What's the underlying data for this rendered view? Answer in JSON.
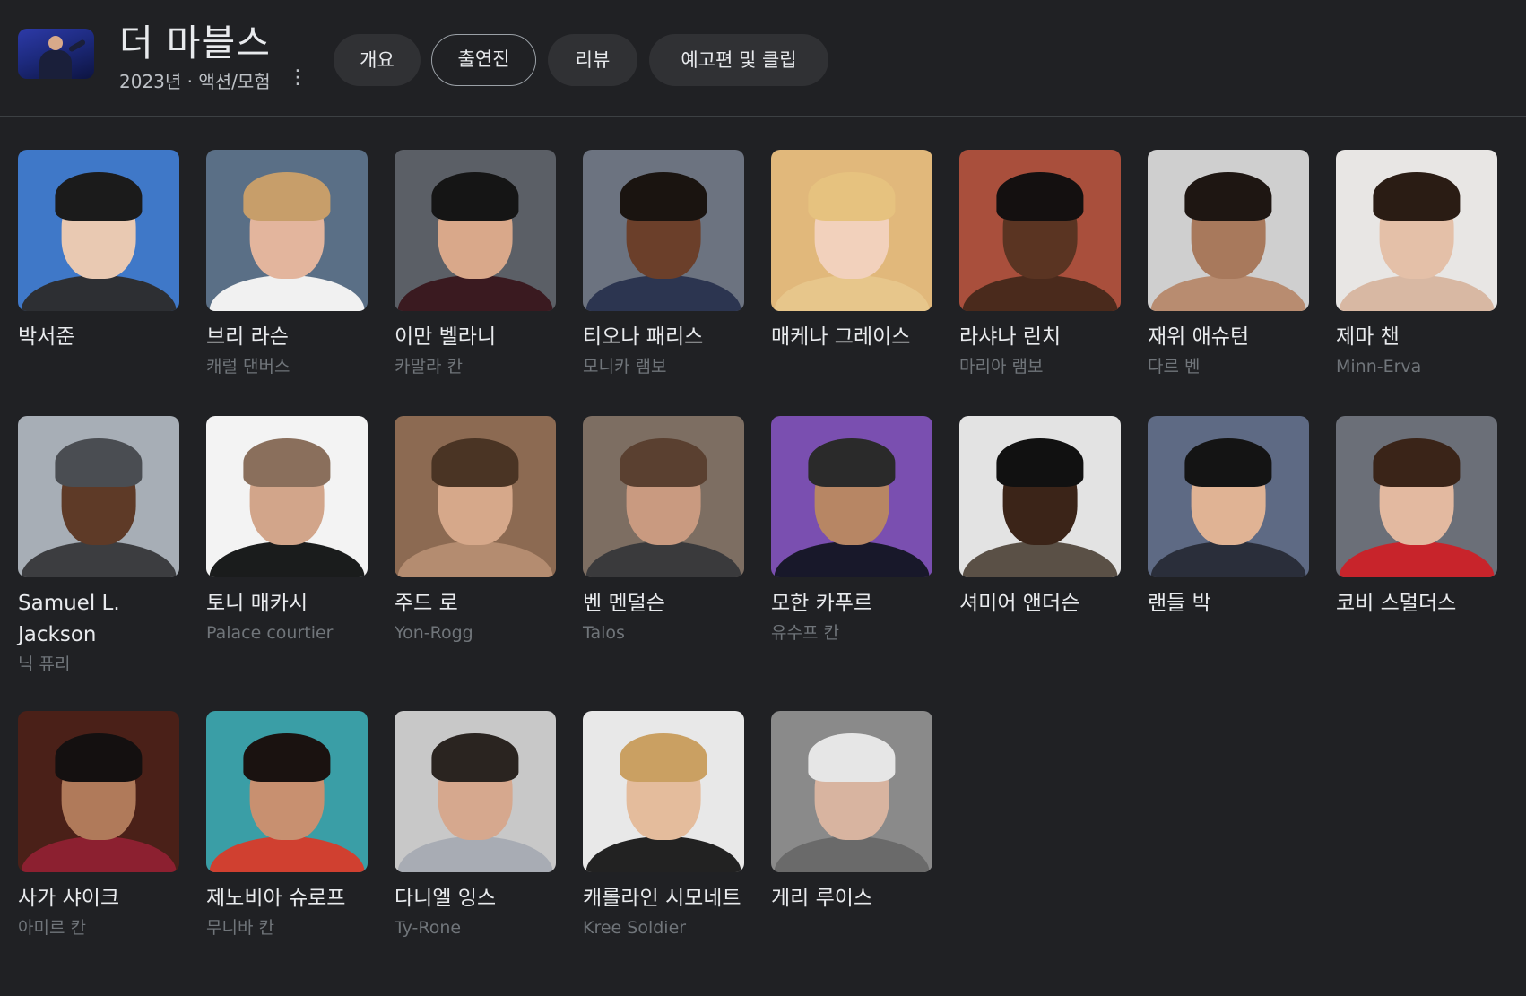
{
  "movie": {
    "title": "더 마블스",
    "subtitle": "2023년 · 액션/모험"
  },
  "tabs": [
    {
      "label": "개요",
      "selected": false
    },
    {
      "label": "출연진",
      "selected": true
    },
    {
      "label": "리뷰",
      "selected": false
    },
    {
      "label": "예고편 및 클립",
      "selected": false
    }
  ],
  "cast": [
    {
      "name": "박서준",
      "role": "",
      "colors": {
        "bg": "#3f78c8",
        "skin": "#e9c9b2",
        "cloth": "#2d2f33",
        "hair": "#1b1b1b"
      }
    },
    {
      "name": "브리 라슨",
      "role": "캐럴 댄버스",
      "colors": {
        "bg": "#5a6f86",
        "skin": "#e3b59d",
        "cloth": "#f1f1f1",
        "hair": "#c79e6a"
      }
    },
    {
      "name": "이만 벨라니",
      "role": "카말라 칸",
      "colors": {
        "bg": "#5b5f66",
        "skin": "#d9a88a",
        "cloth": "#3a1a20",
        "hair": "#151515"
      }
    },
    {
      "name": "티오나 패리스",
      "role": "모니카 램보",
      "colors": {
        "bg": "#6c7380",
        "skin": "#6b3f2a",
        "cloth": "#2c3550",
        "hair": "#1a1410"
      }
    },
    {
      "name": "매케나 그레이스",
      "role": "",
      "colors": {
        "bg": "#e1b87b",
        "skin": "#f2d1bc",
        "cloth": "#e7c68b",
        "hair": "#e6c27f"
      }
    },
    {
      "name": "라샤나 린치",
      "role": "마리아 램보",
      "colors": {
        "bg": "#a94f3c",
        "skin": "#5a3422",
        "cloth": "#4a2a1c",
        "hair": "#141010"
      }
    },
    {
      "name": "재위 애슈턴",
      "role": "다르 벤",
      "colors": {
        "bg": "#cfcfcf",
        "skin": "#a8795c",
        "cloth": "#b88c70",
        "hair": "#1e1612"
      }
    },
    {
      "name": "제마 챈",
      "role": "Minn-Erva",
      "colors": {
        "bg": "#e8e6e4",
        "skin": "#e4c0a8",
        "cloth": "#d8b8a3",
        "hair": "#2a1c14"
      }
    },
    {
      "name": "Samuel L. Jackson",
      "role": "닉 퓨리",
      "colors": {
        "bg": "#a7aeb6",
        "skin": "#5e3a27",
        "cloth": "#3c3d40",
        "hair": "#4a4d52"
      }
    },
    {
      "name": "토니 매카시",
      "role": "Palace courtier",
      "colors": {
        "bg": "#f3f3f3",
        "skin": "#d2a58a",
        "cloth": "#1a1c1c",
        "hair": "#8a6f5c"
      }
    },
    {
      "name": "주드 로",
      "role": "Yon-Rogg",
      "colors": {
        "bg": "#8c6a52",
        "skin": "#d6a88a",
        "cloth": "#b48c70",
        "hair": "#4a3424"
      }
    },
    {
      "name": "벤 멘덜슨",
      "role": "Talos",
      "colors": {
        "bg": "#7d6e62",
        "skin": "#c99a80",
        "cloth": "#3a3a3c",
        "hair": "#5a4030"
      }
    },
    {
      "name": "모한 카푸르",
      "role": "유수프 칸",
      "colors": {
        "bg": "#7a4fb0",
        "skin": "#b78664",
        "cloth": "#18182a",
        "hair": "#2a2a2a"
      }
    },
    {
      "name": "셔미어 앤더슨",
      "role": "",
      "colors": {
        "bg": "#e3e3e3",
        "skin": "#3b2418",
        "cloth": "#5a5046",
        "hair": "#111111"
      }
    },
    {
      "name": "랜들 박",
      "role": "",
      "colors": {
        "bg": "#5e6a84",
        "skin": "#e0b394",
        "cloth": "#2a2e3a",
        "hair": "#141414"
      }
    },
    {
      "name": "코비 스멀더스",
      "role": "",
      "colors": {
        "bg": "#6b6f78",
        "skin": "#e3b9a0",
        "cloth": "#c8242b",
        "hair": "#3a2418"
      }
    },
    {
      "name": "사가 샤이크",
      "role": "아미르 칸",
      "colors": {
        "bg": "#4a2018",
        "skin": "#b07a5a",
        "cloth": "#8c2030",
        "hair": "#141010"
      }
    },
    {
      "name": "제노비아 슈로프",
      "role": "무니바 칸",
      "colors": {
        "bg": "#3a9ea6",
        "skin": "#c89070",
        "cloth": "#d04030",
        "hair": "#1a1210"
      }
    },
    {
      "name": "다니엘 잉스",
      "role": "Ty-Rone",
      "colors": {
        "bg": "#c8c8c8",
        "skin": "#d6a88e",
        "cloth": "#a8acb4",
        "hair": "#2a2420"
      }
    },
    {
      "name": "캐롤라인 시모네트",
      "role": "Kree Soldier",
      "colors": {
        "bg": "#e8e8e8",
        "skin": "#e4bc9c",
        "cloth": "#222222",
        "hair": "#caa062"
      }
    },
    {
      "name": "게리 루이스",
      "role": "",
      "colors": {
        "bg": "#8a8a8a",
        "skin": "#d8b4a0",
        "cloth": "#6a6a6a",
        "hair": "#e6e6e6"
      }
    }
  ]
}
